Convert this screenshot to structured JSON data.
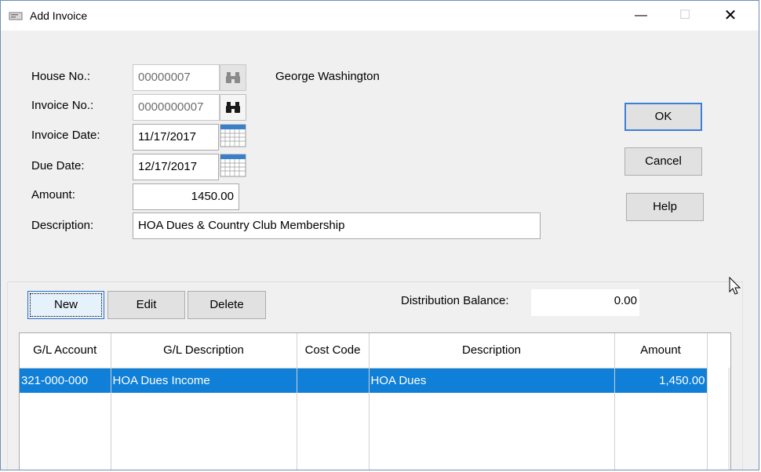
{
  "window": {
    "title": "Add Invoice",
    "icon": "app-icon",
    "controls": {
      "minimize": "—",
      "maximize": "☐",
      "close": "✕"
    }
  },
  "form": {
    "house_no_label": "House No.:",
    "house_no": "00000007",
    "owner_name": "George Washington",
    "invoice_no_label": "Invoice No.:",
    "invoice_no": "0000000007",
    "invoice_date_label": "Invoice Date:",
    "invoice_date": "11/17/2017",
    "due_date_label": "Due Date:",
    "due_date": "12/17/2017",
    "amount_label": "Amount:",
    "amount": "1450.00",
    "description_label": "Description:",
    "description": "HOA Dues & Country Club Membership"
  },
  "buttons": {
    "ok": "OK",
    "cancel": "Cancel",
    "help": "Help",
    "new": "New",
    "edit": "Edit",
    "delete": "Delete"
  },
  "distribution": {
    "label": "Distribution Balance:",
    "value": "0.00"
  },
  "grid": {
    "columns": [
      "G/L Account",
      "G/L Description",
      "Cost Code",
      "Description",
      "Amount"
    ],
    "rows": [
      {
        "gl_account": "321-000-000",
        "gl_description": "HOA Dues Income",
        "cost_code": "",
        "description": "HOA Dues",
        "amount": "1,450.00",
        "selected": true
      }
    ]
  },
  "colors": {
    "selection": "#0f7fd8",
    "default_button_border": "#3c7fd6"
  }
}
